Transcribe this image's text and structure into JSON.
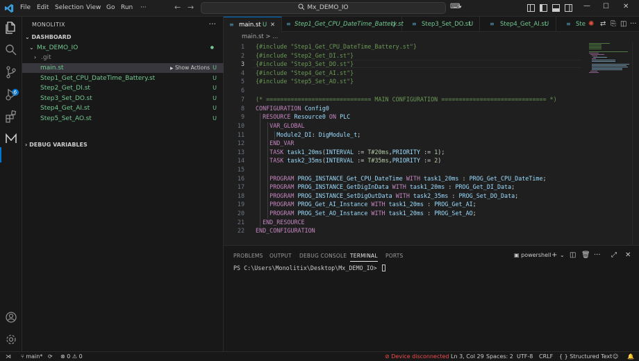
{
  "titlebar": {
    "menus": [
      "File",
      "Edit",
      "Selection",
      "View",
      "Go",
      "Run",
      "···"
    ],
    "search_text": "Mx_DEMO_IO"
  },
  "activity": {
    "source_control_badge": "6"
  },
  "sidebar": {
    "title": "MONOLITIX",
    "dashboard_title": "DASHBOARD",
    "root_folder": "Mx_DEMO_IO",
    "items": [
      {
        "label": ".git",
        "status": ""
      },
      {
        "label": "main.st",
        "status": "U",
        "action": "Show Actions"
      },
      {
        "label": "Step1_Get_CPU_DateTime_Battery.st",
        "status": "U"
      },
      {
        "label": "Step2_Get_DI.st",
        "status": "U"
      },
      {
        "label": "Step3_Set_DO.st",
        "status": "U"
      },
      {
        "label": "Step4_Get_AI.st",
        "status": "U"
      },
      {
        "label": "Step5_Set_AO.st",
        "status": "U"
      }
    ],
    "debug_title": "DEBUG VARIABLES"
  },
  "tabs": [
    {
      "label": "main.st",
      "status": "U"
    },
    {
      "label": "Step1_Get_CPU_DateTime_Battery.st",
      "status": "U"
    },
    {
      "label": "Step3_Set_DO.st",
      "status": "U"
    },
    {
      "label": "Step4_Get_AI.st",
      "status": "U"
    },
    {
      "label": "Ste",
      "status": ""
    }
  ],
  "breadcrumb": "main.st > ...",
  "editor": {
    "line_numbers": [
      "1",
      "2",
      "3",
      "4",
      "5",
      "6",
      "7",
      "8",
      "9",
      "10",
      "11",
      "12",
      "13",
      "14",
      "15",
      "16",
      "17",
      "18",
      "19",
      "20",
      "21",
      "22"
    ],
    "current_line": 3
  },
  "panel": {
    "tabs": [
      "PROBLEMS",
      "OUTPUT",
      "DEBUG CONSOLE",
      "TERMINAL",
      "PORTS"
    ],
    "active_tab": "TERMINAL",
    "shell": "powershell",
    "prompt": "PS C:\\Users\\Monolitix\\Desktop\\Mx_DEMO_IO> "
  },
  "statusbar": {
    "branch": "main*",
    "problems": "⊗ 0 ⚠ 0",
    "device": "Device disconnected",
    "position": "Ln 3, Col 29",
    "spaces": "Spaces: 2",
    "encoding": "UTF-8",
    "eol": "CRLF",
    "language": "Structured Text"
  }
}
